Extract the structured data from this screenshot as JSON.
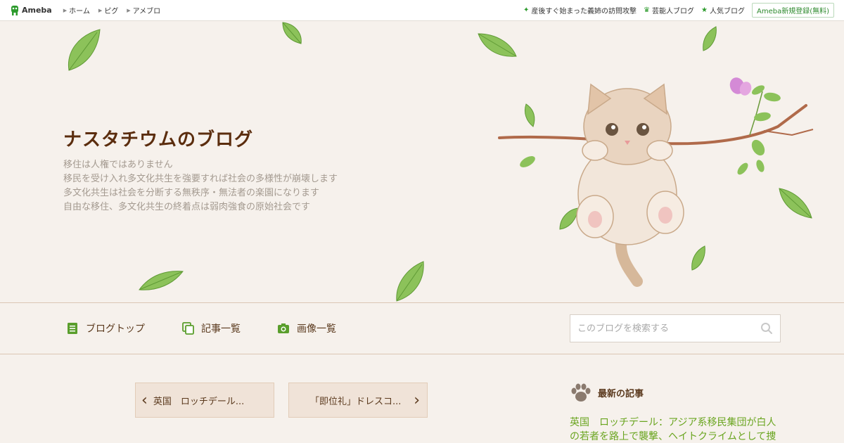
{
  "topbar": {
    "logo_text": "Ameba",
    "nav": [
      "ホーム",
      "ピグ",
      "アメブロ"
    ],
    "links": [
      {
        "label": "産後すぐ始まった義姉の訪問攻撃",
        "icon": "sparkle-icon"
      },
      {
        "label": "芸能人ブログ",
        "icon": "crown-icon"
      },
      {
        "label": "人気ブログ",
        "icon": "star-icon"
      }
    ],
    "signup_label": "Ameba新規登録(無料)"
  },
  "hero": {
    "title": "ナスタチウムのブログ",
    "description": [
      "移住は人権ではありません",
      "移民を受け入れ多文化共生を強要すれば社会の多様性が崩壊します",
      "多文化共生は社会を分断する無秩序・無法者の楽園になります",
      "自由な移住、多文化共生の終着点は弱肉強食の原始社会です"
    ]
  },
  "navbar": {
    "items": [
      {
        "label": "ブログトップ",
        "icon": "document-icon"
      },
      {
        "label": "記事一覧",
        "icon": "copy-icon"
      },
      {
        "label": "画像一覧",
        "icon": "camera-icon"
      }
    ],
    "search_placeholder": "このブログを検索する"
  },
  "articles": {
    "prev_label": "英国　ロッチデール...",
    "next_label": "「即位礼」ドレスコ..."
  },
  "sidebar": {
    "heading": "最新の記事",
    "latest_text": "英国　ロッチデール：アジア系移民集団が白人の若者を路上で襲撃、ヘイトクライムとして捜"
  },
  "colors": {
    "accent_green": "#6aa520",
    "title_brown": "#5b2d0e",
    "background": "#f6f1ec"
  }
}
